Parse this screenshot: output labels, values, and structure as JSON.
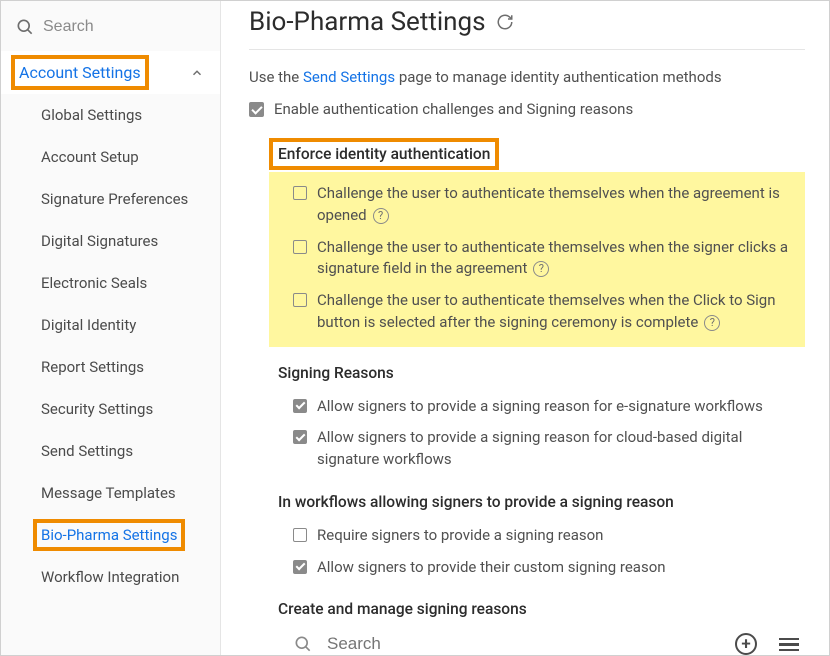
{
  "sidebar": {
    "search_placeholder": "Search",
    "header": "Account Settings",
    "items": [
      {
        "label": "Global Settings"
      },
      {
        "label": "Account Setup"
      },
      {
        "label": "Signature Preferences"
      },
      {
        "label": "Digital Signatures"
      },
      {
        "label": "Electronic Seals"
      },
      {
        "label": "Digital Identity"
      },
      {
        "label": "Report Settings"
      },
      {
        "label": "Security Settings"
      },
      {
        "label": "Send Settings"
      },
      {
        "label": "Message Templates"
      },
      {
        "label": "Bio-Pharma Settings"
      },
      {
        "label": "Workflow Integration"
      }
    ]
  },
  "page": {
    "title": "Bio-Pharma Settings",
    "intro_pre": "Use the ",
    "intro_link": "Send Settings",
    "intro_post": " page to manage identity authentication methods",
    "enable_label": "Enable authentication challenges and Signing reasons"
  },
  "enforce": {
    "title": "Enforce identity authentication",
    "opt1": "Challenge the user to authenticate themselves when the agreement is opened",
    "opt2": "Challenge the user to authenticate themselves when the signer clicks a signature field in the agreement",
    "opt3": "Challenge the user to authenticate themselves when the Click to Sign button is selected after the signing ceremony is complete"
  },
  "reasons": {
    "title": "Signing Reasons",
    "opt1": "Allow signers to provide a signing reason for e-signature workflows",
    "opt2": "Allow signers to provide a signing reason for cloud-based digital signature workflows"
  },
  "workflows": {
    "title": "In workflows allowing signers to provide a signing reason",
    "opt1": "Require signers to provide a signing reason",
    "opt2": "Allow signers to provide their custom signing reason"
  },
  "manage": {
    "title": "Create and manage signing reasons",
    "search_placeholder": "Search"
  }
}
